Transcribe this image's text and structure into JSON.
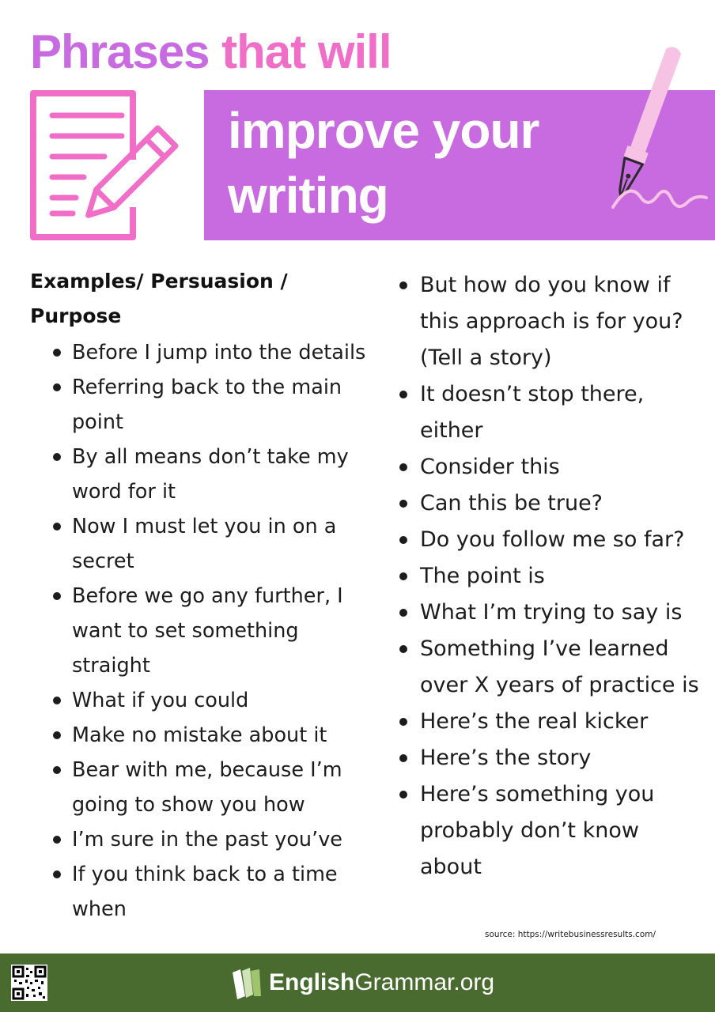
{
  "header": {
    "title_line1_part1": "Phrases",
    "title_line1_part2": "that will",
    "banner_line1": "improve your",
    "banner_line2": "writing",
    "colors": {
      "purple": "#c86ae0",
      "pink": "#f06ec8",
      "light_pink": "#f7c3e4"
    },
    "icons": [
      "document-pencil-icon",
      "fountain-pen-icon"
    ]
  },
  "left_column": {
    "heading_line1": "Examples/ Persuasion /",
    "heading_line2": "Purpose",
    "items": [
      "Before I jump into the details",
      "Referring back to the main point",
      "By all means don’t take my word for it",
      "Now I must let you in on a secret",
      "Before we go any further, I want to set something straight",
      "What if you could",
      "Make no mistake about it",
      "Bear with me, because I’m going to show you how",
      "I’m sure in the past you’ve",
      "If you think back to a time when"
    ]
  },
  "right_column": {
    "items": [
      " But how do you know if this approach is for you? (Tell a story)",
      "It doesn’t stop there, either",
      "Consider this",
      "Can this be true?",
      "Do you follow me so far?",
      "The point is",
      "What I’m trying to say is",
      "Something I’ve learned over X years of practice is",
      "Here’s the real kicker",
      "Here’s the story",
      "Here’s something you probably don’t know about"
    ]
  },
  "source": "source: https://writebusinessresults.com/",
  "footer": {
    "brand_bold": "English",
    "brand_regular": "Grammar.org",
    "background": "#4a6b2f",
    "icons": [
      "qr-code-icon",
      "book-logo-icon"
    ]
  }
}
